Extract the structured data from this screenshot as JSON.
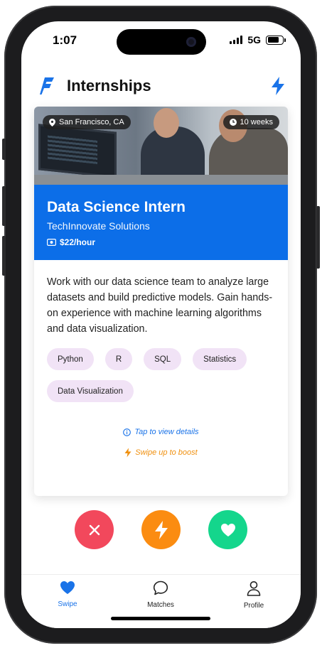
{
  "status_bar": {
    "time": "1:07",
    "network": "5G",
    "battery_level": 0.75
  },
  "header": {
    "title": "Internships",
    "logo_icon": "brand-f-icon",
    "boost_icon": "lightning-icon"
  },
  "card": {
    "location": "San Francisco, CA",
    "duration": "10 weeks",
    "job_title": "Data Science Intern",
    "company": "TechInnovate Solutions",
    "pay": "$22/hour",
    "description": "Work with our data science team to analyze large datasets and build predictive models. Gain hands-on experience with machine learning algorithms and data visualization.",
    "tags": [
      "Python",
      "R",
      "SQL",
      "Statistics",
      "Data Visualization"
    ],
    "details_hint": "Tap to view details",
    "boost_hint": "Swipe up to boost"
  },
  "actions": {
    "pass_icon": "x-icon",
    "boost_icon": "lightning-icon",
    "like_icon": "heart-icon"
  },
  "tabs": [
    {
      "label": "Swipe",
      "icon": "heart-icon",
      "active": true
    },
    {
      "label": "Matches",
      "icon": "chat-bubble-icon",
      "active": false
    },
    {
      "label": "Profile",
      "icon": "person-icon",
      "active": false
    }
  ],
  "colors": {
    "accent": "#1a73e8",
    "banner": "#0c6ee8",
    "pass": "#f2485c",
    "boost": "#fb8c11",
    "like": "#14d68c",
    "tag_bg": "#f1e3f6"
  }
}
